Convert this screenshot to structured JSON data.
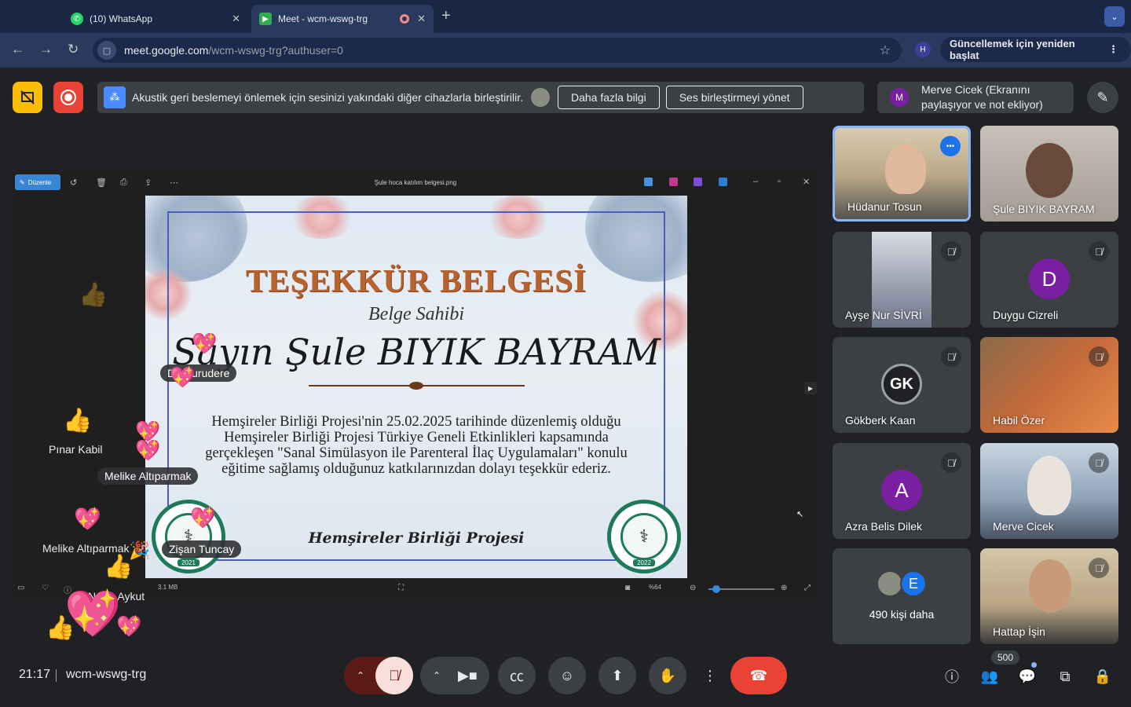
{
  "browser": {
    "tabs": [
      {
        "label": "(10) WhatsApp",
        "icon": "whatsapp-icon"
      },
      {
        "label": "Meet - wcm-wswg-trg",
        "icon": "meet-icon"
      }
    ],
    "url_host": "meet.google.com",
    "url_path": "/wcm-wswg-trg?authuser=0",
    "profile_initial": "H",
    "update_label": "Güncellemek için yeniden başlat"
  },
  "meet": {
    "notice_text": "Akustik geri beslemeyi önlemek için sesinizi yakındaki diğer cihazlarla birleştirilir.",
    "more_info_label": "Daha fazla bilgi",
    "manage_label": "Ses birleştirmeyi yönet",
    "presenter_initial": "M",
    "presenter_line1": "Merve Cicek (Ekranını",
    "presenter_line2": "paylaşıyor ve not ekliyor)",
    "clock": "21:17",
    "meeting_code": "wcm-wswg-trg",
    "participant_count": "500"
  },
  "viewer": {
    "edit_label": "Düzenle",
    "file_title": "Şule hoca katılım belgesi.png",
    "file_size": "3.1 MB",
    "zoom_label": "%64",
    "zoom_fraction": 0.12
  },
  "certificate": {
    "title": "TEŞEKKÜR BELGESİ",
    "subtitle": "Belge Sahibi",
    "name": "Sayın Şule BIYIK BAYRAM",
    "body_line1": "Hemşireler Birliği Projesi'nin 25.02.2025 tarihinde düzenlemiş olduğu",
    "body_line2": "Hemşireler Birliği Projesi Türkiye Geneli Etkinlikleri kapsamında",
    "body_line3": "gerçekleşen \"Sanal Simülasyon ile Parenteral İlaç Uygulamaları\" konulu",
    "body_line4": "eğitime sağlamış olduğunuz katkılarınızdan dolayı teşekkür ederiz.",
    "footer": "Hemşireler Birliği Projesi",
    "seal_left_year": "2021",
    "seal_right_year": "2022"
  },
  "reactions": {
    "chip1": "Kurudere",
    "chip1_prefix": "D",
    "name1": "Pınar Kabil",
    "chip2": "Melike Altıparmak",
    "name2": "Melike Altıparmak",
    "chip3": "Zişan Tuncay",
    "name3": "Aykut",
    "name3_prefix": "N"
  },
  "tiles": [
    {
      "name": "Hüdanur Tosun",
      "speaking": true,
      "muted": false
    },
    {
      "name": "Şule BIYIK BAYRAM",
      "speaking": false,
      "muted": false
    },
    {
      "name": "Ayşe Nur SİVRİ",
      "speaking": false,
      "muted": true
    },
    {
      "name": "Duygu Cizreli",
      "initial": "D",
      "color": "#7b1fa2",
      "muted": true
    },
    {
      "name": "Gökberk Kaan",
      "initial": "GK",
      "color": "#202124",
      "muted": true
    },
    {
      "name": "Habil Özer",
      "muted": true
    },
    {
      "name": "Azra Belis Dilek",
      "initial": "A",
      "color": "#7b1fa2",
      "muted": true
    },
    {
      "name": "Merve Cicek",
      "muted": true
    },
    {
      "name": "490 kişi daha",
      "extra_initial": "E"
    },
    {
      "name": "Hattap İşin",
      "muted": true
    }
  ],
  "colors": {
    "accent": "#8ab4f8",
    "end_call": "#ea4335",
    "mic_off": "#f9dedc",
    "record": "#ea4335",
    "present_off": "#fbbc04"
  }
}
